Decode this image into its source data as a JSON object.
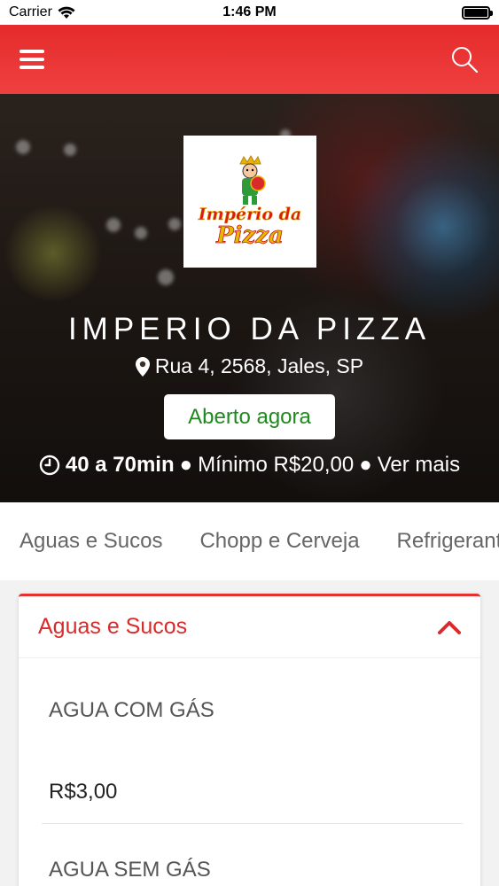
{
  "status_bar": {
    "carrier": "Carrier",
    "time": "1:46 PM"
  },
  "header": {
    "accent_color": "#e52b2b"
  },
  "hero": {
    "logo": {
      "line1": "Império da",
      "line2": "Pizza"
    },
    "restaurant_name": "IMPERIO DA PIZZA",
    "address": "Rua 4, 2568, Jales, SP",
    "status_badge": "Aberto agora",
    "delivery_time": "40 a 70min",
    "minimum_order": "Mínimo R$20,00",
    "more_link": "Ver mais"
  },
  "tabs": [
    {
      "label": "Aguas e Sucos"
    },
    {
      "label": "Chopp e Cerveja"
    },
    {
      "label": "Refrigerantes"
    }
  ],
  "section": {
    "title": "Aguas e Sucos",
    "items": [
      {
        "name": "AGUA COM GÁS",
        "price": "R$3,00"
      },
      {
        "name": "AGUA SEM GÁS"
      }
    ]
  }
}
